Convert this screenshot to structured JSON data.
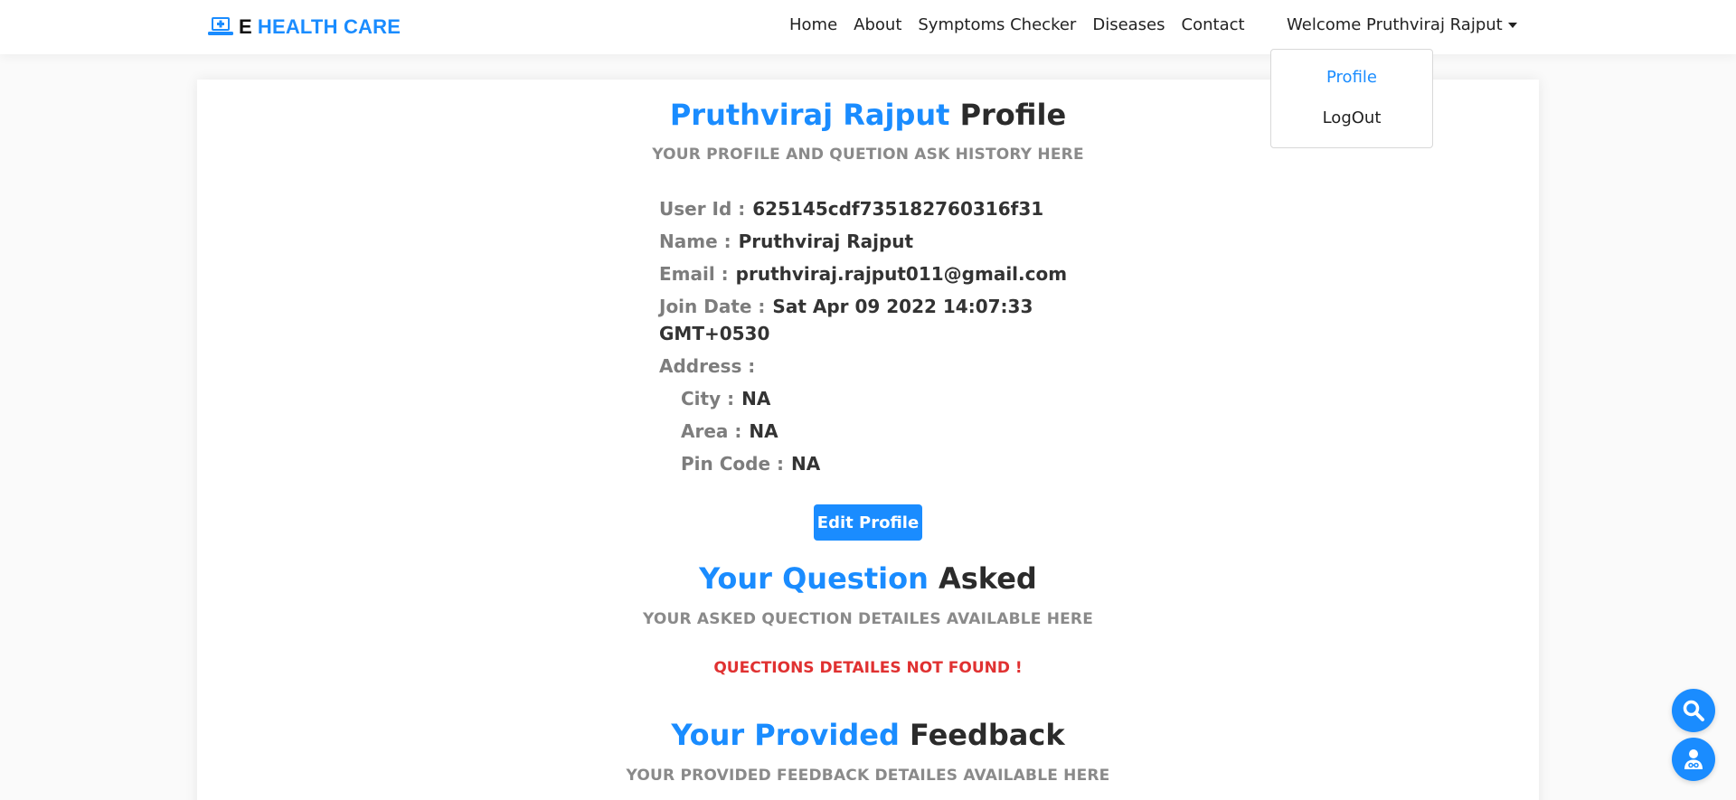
{
  "brand": {
    "letter": "E",
    "name": "HEALTH CARE",
    "accent": "#1a8cff"
  },
  "nav": {
    "links": [
      "Home",
      "About",
      "Symptoms Checker",
      "Diseases",
      "Contact"
    ],
    "welcome": "Welcome Pruthviraj Rajput"
  },
  "dropdown": {
    "profile": "Profile",
    "logout": "LogOut"
  },
  "profile": {
    "title_name": "Pruthviraj Rajput",
    "title_suffix": "Profile",
    "subtitle": "YOUR PROFILE AND QUETION ASK HISTORY HERE",
    "fields": {
      "user_id_label": "User Id :",
      "user_id": "625145cdf735182760316f31",
      "name_label": "Name :",
      "name": "Pruthviraj Rajput",
      "email_label": "Email :",
      "email": "pruthviraj.rajput011@gmail.com",
      "join_label": "Join Date :",
      "join_date": "Sat Apr 09 2022 14:07:33",
      "join_tz": "GMT+0530",
      "address_label": "Address :",
      "city_label": "City :",
      "city": "NA",
      "area_label": "Area :",
      "area": "NA",
      "pin_label": "Pin Code :",
      "pin": "NA"
    },
    "edit_button": "Edit Profile"
  },
  "questions": {
    "title_blue": "Your Question",
    "title_dark": "Asked",
    "subtitle": "YOUR ASKED QUECTION DETAILES AVAILABLE HERE",
    "empty": "QUECTIONS DETAILES NOT FOUND !"
  },
  "feedback": {
    "title_blue": "Your Provided",
    "title_dark": "Feedback",
    "subtitle": "YOUR PROVIDED FEEDBACK DETAILES AVAILABLE HERE"
  },
  "fabs": {
    "search_icon": "search-icon",
    "doctor_icon": "doctor-icon"
  }
}
